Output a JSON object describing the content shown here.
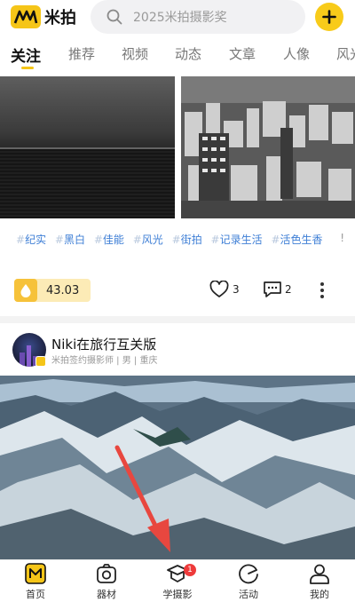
{
  "app": {
    "name": "米拍",
    "brand_color": "#f5c518"
  },
  "search": {
    "placeholder": "2025米拍摄影奖"
  },
  "tabs": [
    {
      "label": "关注",
      "active": true
    },
    {
      "label": "推荐"
    },
    {
      "label": "视频"
    },
    {
      "label": "动态"
    },
    {
      "label": "文章"
    },
    {
      "label": "人像"
    },
    {
      "label": "风光"
    }
  ],
  "post1": {
    "tags": [
      "纪实",
      "黑白",
      "佳能",
      "风光",
      "街拍",
      "记录生活",
      "活色生香"
    ],
    "tag_trailing": "!",
    "coin_value": "43.03",
    "like_count": "3",
    "comment_count": "2"
  },
  "post2": {
    "author_name": "Niki在旅行互关版",
    "author_meta": "米拍签约摄影师 | 男 | 重庆"
  },
  "bottom_nav": [
    {
      "label": "首页",
      "icon": "home-m-icon",
      "active": true
    },
    {
      "label": "器材",
      "icon": "camera-icon"
    },
    {
      "label": "学摄影",
      "icon": "graduation-cap-icon",
      "badge": "1"
    },
    {
      "label": "活动",
      "icon": "activity-circle-icon"
    },
    {
      "label": "我的",
      "icon": "user-icon"
    }
  ]
}
